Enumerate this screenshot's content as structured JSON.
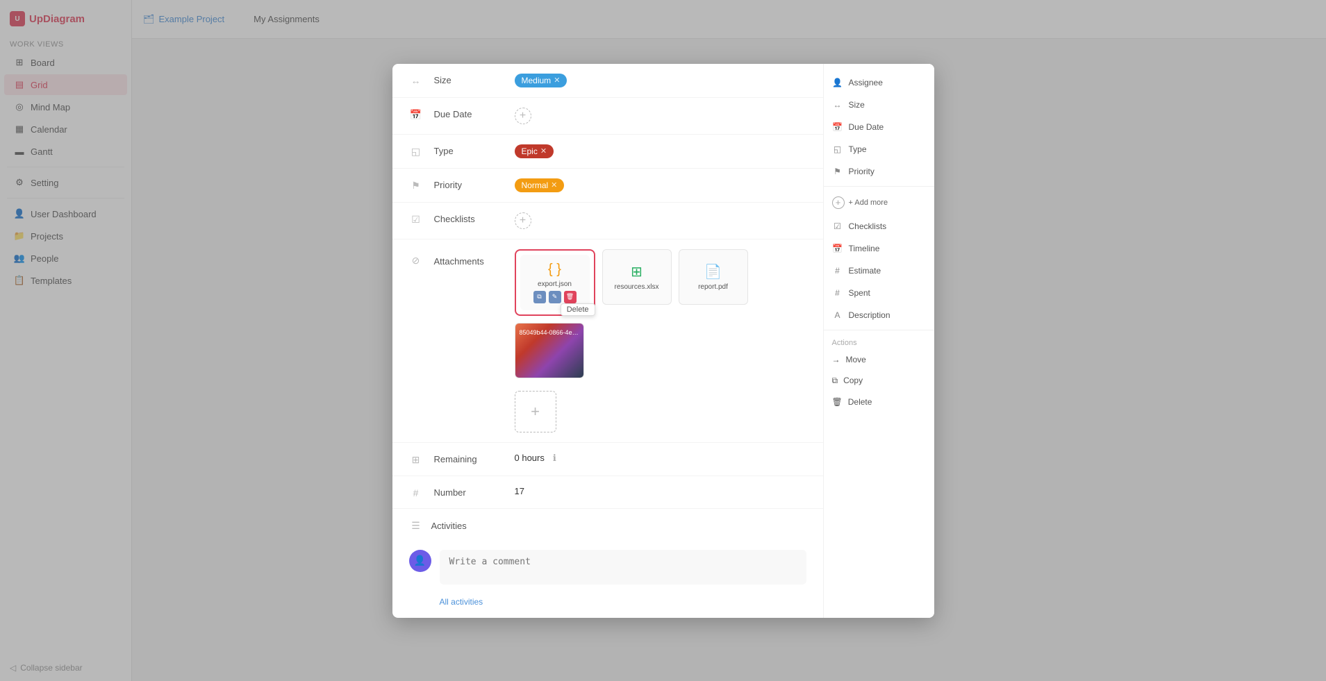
{
  "app": {
    "name": "UpDiagram",
    "project": "Example Project"
  },
  "sidebar": {
    "sections": [
      {
        "label": "Work Views",
        "items": [
          {
            "id": "board",
            "label": "Board",
            "icon": "⊞",
            "active": false
          },
          {
            "id": "grid",
            "label": "Grid",
            "icon": "▤",
            "active": true
          },
          {
            "id": "mindmap",
            "label": "Mind Map",
            "icon": "◎",
            "active": false
          },
          {
            "id": "calendar",
            "label": "Calendar",
            "icon": "▦",
            "active": false
          },
          {
            "id": "gantt",
            "label": "Gantt",
            "icon": "▬",
            "active": false
          }
        ]
      }
    ],
    "nav_items": [
      {
        "id": "user-dashboard",
        "label": "User Dashboard",
        "icon": "👤"
      },
      {
        "id": "projects",
        "label": "Projects",
        "icon": "📁"
      },
      {
        "id": "people",
        "label": "People",
        "icon": "👥"
      },
      {
        "id": "templates",
        "label": "Templates",
        "icon": "📋"
      }
    ],
    "bottom": {
      "label": "Collapse sidebar"
    },
    "setting": {
      "label": "Setting",
      "icon": "⚙"
    }
  },
  "top_bar": {
    "my_assignments": "My Assignments",
    "views": [
      "#",
      "□",
      "☰"
    ]
  },
  "modal": {
    "fields": {
      "size": {
        "label": "Size",
        "value": "Medium",
        "icon": "↔"
      },
      "due_date": {
        "label": "Due Date",
        "icon": "📅"
      },
      "type": {
        "label": "Type",
        "value": "Epic",
        "icon": "◱"
      },
      "priority": {
        "label": "Priority",
        "value": "Normal",
        "icon": "⚑"
      },
      "checklists": {
        "label": "Checklists",
        "icon": "☑"
      },
      "attachments": {
        "label": "Attachments",
        "icon": "⊘",
        "files": [
          {
            "name": "export.json",
            "type": "json",
            "selected": true
          },
          {
            "name": "resources.xlsx",
            "type": "xlsx",
            "selected": false
          },
          {
            "name": "report.pdf",
            "type": "pdf",
            "selected": false
          },
          {
            "name": "85049b44-0866-4e3e-...",
            "type": "image",
            "selected": false
          }
        ],
        "delete_label": "Delete"
      },
      "remaining": {
        "label": "Remaining",
        "value": "0 hours",
        "icon": "⊞"
      },
      "number": {
        "label": "Number",
        "value": "17",
        "icon": "#"
      },
      "activities": {
        "label": "Activities",
        "placeholder": "Write a comment",
        "all_label": "All activities",
        "icon": "☰"
      }
    },
    "right_panel": {
      "properties": [
        {
          "id": "assignee",
          "label": "Assignee",
          "icon": "👤"
        },
        {
          "id": "size",
          "label": "Size",
          "icon": "↔"
        },
        {
          "id": "due-date",
          "label": "Due Date",
          "icon": "📅"
        },
        {
          "id": "type",
          "label": "Type",
          "icon": "◱"
        },
        {
          "id": "priority",
          "label": "Priority",
          "icon": "⚑"
        }
      ],
      "add_more_label": "+ Add more",
      "extra_properties": [
        {
          "id": "checklists",
          "label": "Checklists",
          "icon": "☑"
        },
        {
          "id": "timeline",
          "label": "Timeline",
          "icon": "📅"
        },
        {
          "id": "estimate",
          "label": "Estimate",
          "icon": "#"
        },
        {
          "id": "spent",
          "label": "Spent",
          "icon": "#"
        },
        {
          "id": "description",
          "label": "Description",
          "icon": "A"
        }
      ],
      "actions_label": "Actions",
      "actions": [
        {
          "id": "move",
          "label": "Move",
          "icon": "→"
        },
        {
          "id": "copy",
          "label": "Copy",
          "icon": "⧉"
        },
        {
          "id": "delete",
          "label": "Delete",
          "icon": "🗑"
        }
      ]
    }
  },
  "colors": {
    "brand": "#e0435c",
    "blue_tag": "#3b9ede",
    "epic_tag": "#c0392b",
    "normal_tag": "#f39c12",
    "purple": "#6c5ce7",
    "link": "#4a90d9"
  }
}
